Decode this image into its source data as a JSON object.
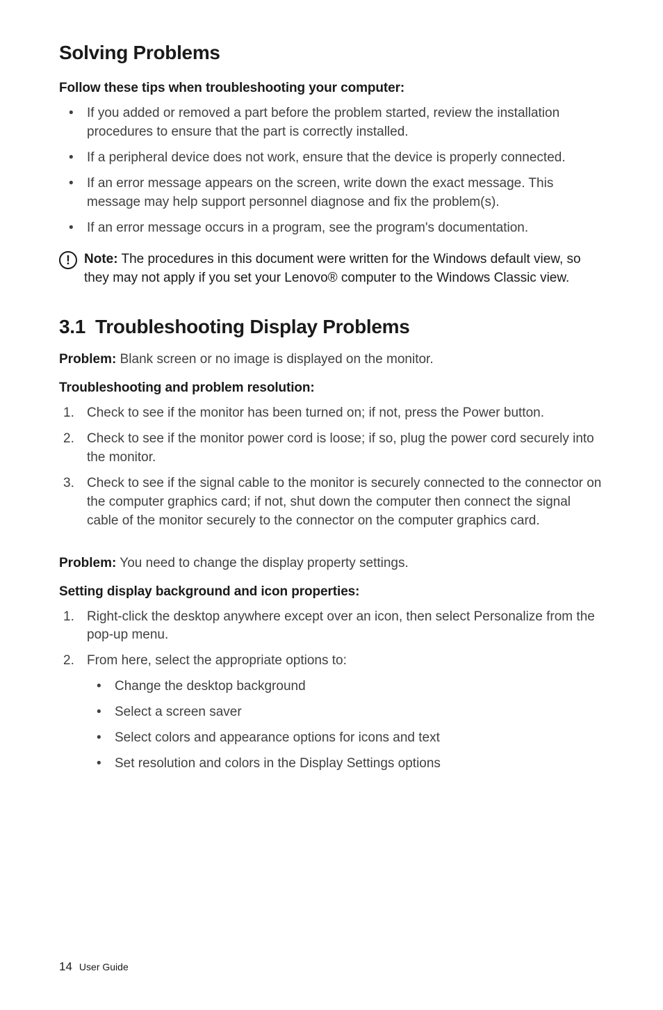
{
  "heading1": "Solving Problems",
  "tips_intro": "Follow these tips when troubleshooting your computer:",
  "tips": [
    "If you added or removed a part before the problem started, review the installation procedures to ensure that the part is correctly installed.",
    "If a peripheral device does not work, ensure that the device is properly connected.",
    "If an error message appears on the screen, write down the exact message. This message may help support personnel diagnose and fix the problem(s).",
    "If an error message occurs in a program, see the program's documentation."
  ],
  "note": {
    "label": "Note:",
    "text": " The procedures in this document were written for the Windows default view, so they may not apply if you set your Lenovo® computer to the Windows Classic view."
  },
  "section": {
    "number": "3.1",
    "title": "Troubleshooting Display Problems"
  },
  "problem1": {
    "label": "Problem:",
    "text": " Blank screen or no image is displayed on the monitor."
  },
  "resolution_heading": "Troubleshooting and problem resolution:",
  "resolution_steps": [
    "Check to see if the monitor has been turned on; if not, press the Power button.",
    "Check to see if the monitor power cord is loose; if so, plug the power cord securely into the monitor.",
    "Check to see if the signal cable to the monitor is securely connected to the connector on the computer graphics card; if not, shut down the computer then connect the signal cable of the monitor securely to the connector on the computer graphics card."
  ],
  "problem2": {
    "label": "Problem:",
    "text": " You need to change the display property settings."
  },
  "setting_heading": "Setting display background and icon properties:",
  "setting_steps": [
    "Right-click the desktop anywhere except over an icon, then select Personalize from the pop-up menu.",
    "From here, select the appropriate options to:"
  ],
  "setting_sub": [
    "Change the desktop background",
    "Select a screen saver",
    "Select colors and appearance options for icons and text",
    "Set resolution and colors in the Display Settings options"
  ],
  "footer": {
    "page": "14",
    "label": "User Guide"
  }
}
